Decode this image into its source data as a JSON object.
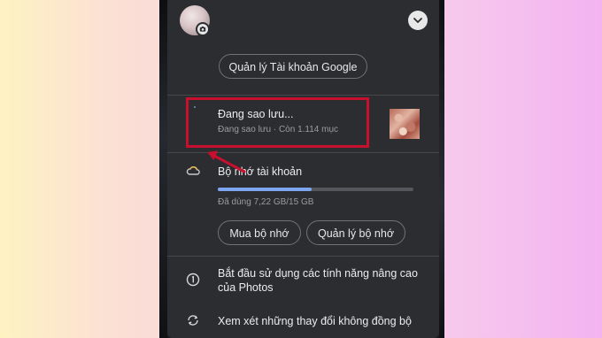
{
  "account": {
    "manage_google_label": "Quản lý Tài khoản Google"
  },
  "backup": {
    "title": "Đang sao lưu...",
    "subtitle": "Đang sao lưu · Còn 1.114 mục"
  },
  "storage": {
    "title": "Bộ nhớ tài khoản",
    "used_label": "Đã dùng 7,22 GB/15 GB",
    "used_fraction": 0.481,
    "buy_label": "Mua bộ nhớ",
    "manage_label": "Quản lý bộ nhớ"
  },
  "menu": {
    "advanced_features": "Bắt đầu sử dụng các tính năng nâng cao của Photos",
    "sync_review": "Xem xét những thay đổi không đồng bộ"
  },
  "icons": {
    "avatar_badge": "camera-icon",
    "collapse": "chevron-down-icon",
    "storage": "cloud-icon",
    "advanced": "info-icon",
    "sync": "sync-icon",
    "annotation": "red-arrow"
  },
  "colors": {
    "highlight": "#c8102e",
    "storage_bar": "#7ea5f0",
    "sheet_bg": "#2c2d30"
  }
}
